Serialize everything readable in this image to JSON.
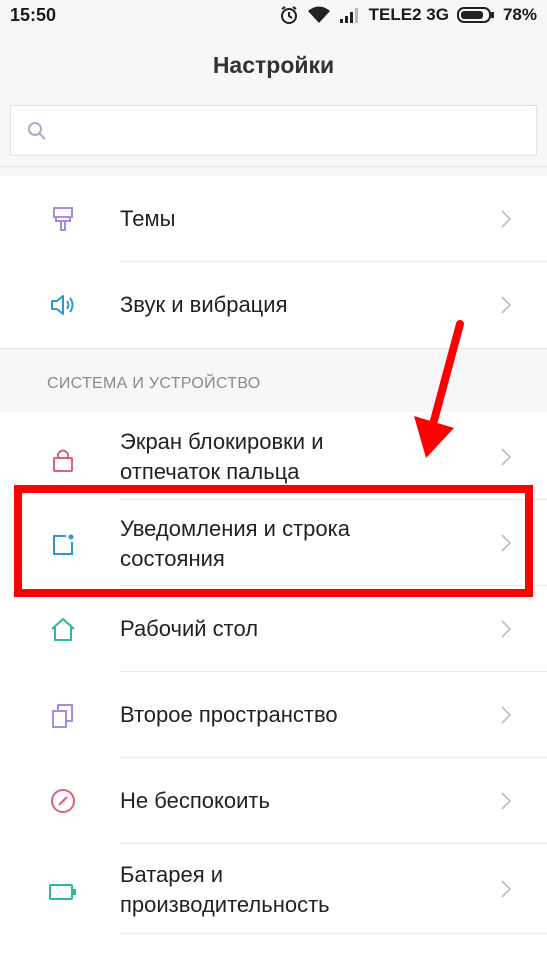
{
  "status_bar": {
    "time": "15:50",
    "carrier": "TELE2 3G",
    "battery": "78%",
    "icons": [
      "alarm-icon",
      "wifi-icon",
      "signal-icon",
      "battery-icon"
    ]
  },
  "header": {
    "title": "Настройки"
  },
  "search": {
    "placeholder": "",
    "value": ""
  },
  "section_system": {
    "title": "СИСТЕМА И УСТРОЙСТВО"
  },
  "items": [
    {
      "label": "Темы",
      "icon": "brush-icon",
      "color": "#a88ae0"
    },
    {
      "label": "Звук и вибрация",
      "icon": "speaker-icon",
      "color": "#2a9ad6"
    },
    {
      "label": "Экран блокировки и\nотпечаток пальца",
      "icon": "lock-icon",
      "color": "#e0607a"
    },
    {
      "label": "Уведомления и строка\nсостояния",
      "icon": "notification-icon",
      "color": "#2a9ad6"
    },
    {
      "label": "Рабочий стол",
      "icon": "home-icon",
      "color": "#2bb8a0"
    },
    {
      "label": "Второе пространство",
      "icon": "dual-space-icon",
      "color": "#a88ae0"
    },
    {
      "label": "Не беспокоить",
      "icon": "do-not-disturb-icon",
      "color": "#e0607a"
    },
    {
      "label": "Батарея и\nпроизводительность",
      "icon": "battery-saver-icon",
      "color": "#2bb8a0"
    }
  ],
  "annotation": {
    "highlight_color": "#ff0000"
  }
}
